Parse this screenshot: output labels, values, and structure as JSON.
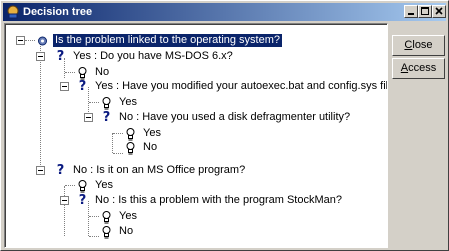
{
  "window": {
    "title": "Decision tree",
    "icon": "decision-tree-app-icon"
  },
  "caption_buttons": {
    "minimize": "minimize-icon",
    "maximize": "maximize-icon",
    "close": "close-icon"
  },
  "buttons": {
    "close": {
      "label": "Close",
      "accel": "C",
      "rest": "lose"
    },
    "access": {
      "label": "Access",
      "accel": "A",
      "rest": "ccess"
    }
  },
  "tree": {
    "root": "Is the problem linked to the operating system?",
    "n1": "Yes : Do you have MS-DOS 6.x?",
    "n1a": "No",
    "n1b": "Yes : Have you modified your autoexec.bat and config.sys files?",
    "n1b1": "Yes",
    "n1b2": "No : Have you used a disk defragmenter utility?",
    "n1b2a": "Yes",
    "n1b2b": "No",
    "n2": "No : Is it on an MS Office program?",
    "n2a": "Yes",
    "n2b": "No : Is this a problem with the program StockMan?",
    "n2b1": "Yes",
    "n2b2": "No"
  },
  "icons": {
    "question": "question-mark-icon",
    "answer": "lightbulb-icon",
    "root": "root-node-icon"
  }
}
